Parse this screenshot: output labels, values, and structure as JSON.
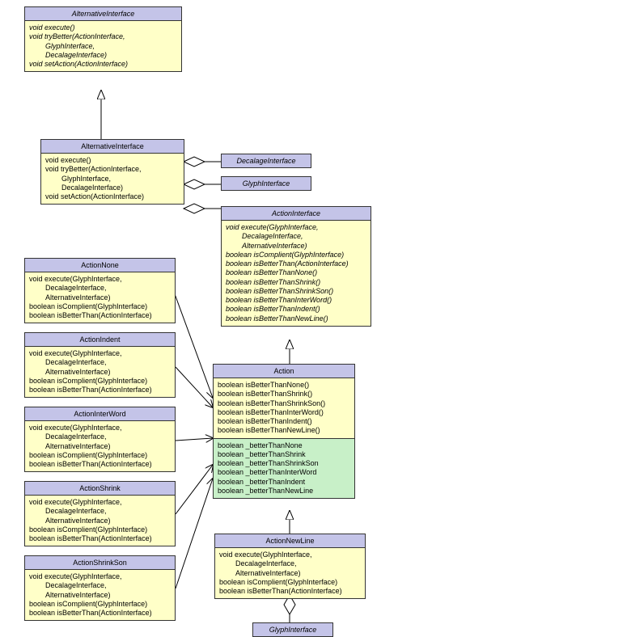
{
  "classes": {
    "alt_iface_top": {
      "name": "AlternativeInterface",
      "methods": [
        "void execute()",
        "void tryBetter(ActionInterface,",
        "        GlyphInterface,",
        "        DecalageInterface)",
        "void setAction(ActionInterface)"
      ]
    },
    "alt_iface_mid": {
      "name": "AlternativeInterface",
      "methods": [
        "void execute()",
        "void tryBetter(ActionInterface,",
        "        GlyphInterface,",
        "        DecalageInterface)",
        "void setAction(ActionInterface)"
      ]
    },
    "decalage": {
      "name": "DecalageInterface"
    },
    "glyph1": {
      "name": "GlyphInterface"
    },
    "glyph2": {
      "name": "GlyphInterface"
    },
    "action_iface": {
      "name": "ActionInterface",
      "methods": [
        "void execute(GlyphInterface,",
        "        DecalageInterface,",
        "        AlternativeInterface)",
        "boolean isComplient(GlyphInterface)",
        "boolean isBetterThan(ActionInterface)",
        "boolean isBetterThanNone()",
        "boolean isBetterThanShrink()",
        "boolean isBetterThanShrinkSon()",
        "boolean isBetterThanInterWord()",
        "boolean isBetterThanIndent()",
        "boolean isBetterThanNewLine()"
      ]
    },
    "action": {
      "name": "Action",
      "methods": [
        "boolean isBetterThanNone()",
        "boolean isBetterThanShrink()",
        "boolean isBetterThanShrinkSon()",
        "boolean isBetterThanInterWord()",
        "boolean isBetterThanIndent()",
        "boolean isBetterThanNewLine()"
      ],
      "fields": [
        "boolean _betterThanNone",
        "boolean _betterThanShrink",
        "boolean _betterThanShrinkSon",
        "boolean _betterThanInterWord",
        "boolean _betterThanIndent",
        "boolean _betterThanNewLine"
      ]
    },
    "action_none": {
      "name": "ActionNone"
    },
    "action_indent": {
      "name": "ActionIndent"
    },
    "action_interword": {
      "name": "ActionInterWord"
    },
    "action_shrink": {
      "name": "ActionShrink"
    },
    "action_shrinkson": {
      "name": "ActionShrinkSon"
    },
    "action_newline": {
      "name": "ActionNewLine"
    },
    "common_impl": [
      "void execute(GlyphInterface,",
      "        DecalageInterface,",
      "        AlternativeInterface)",
      "boolean isComplient(GlyphInterface)",
      "boolean isBetterThan(ActionInterface)"
    ]
  }
}
